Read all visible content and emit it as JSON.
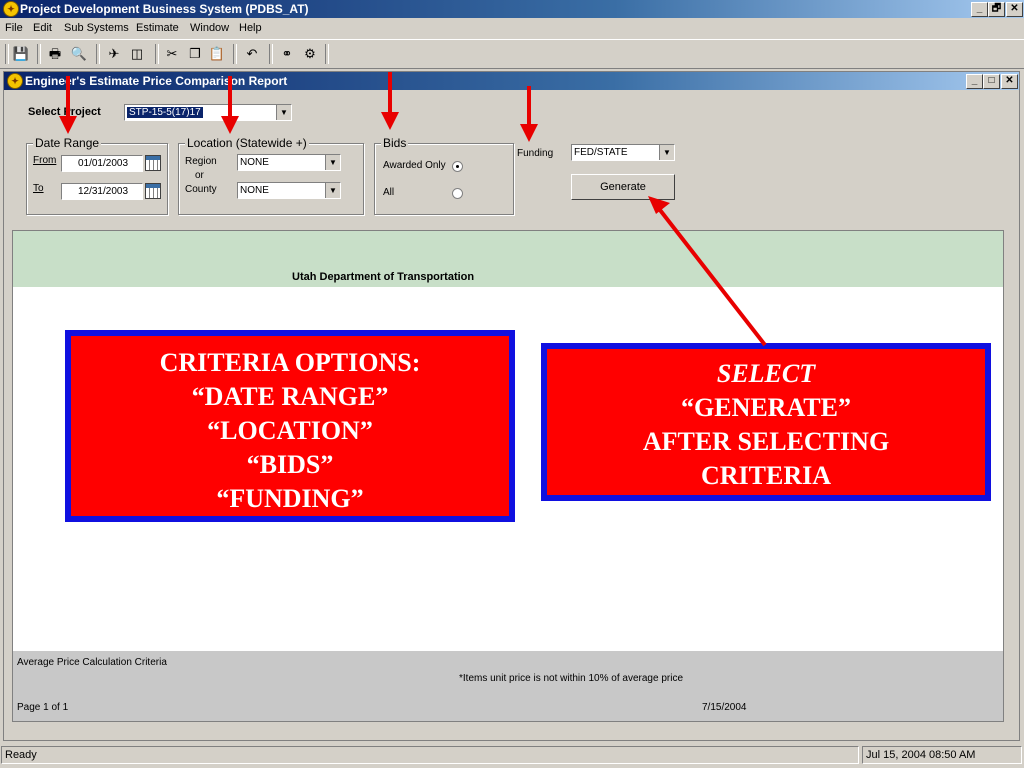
{
  "app": {
    "title": "Project Development Business System (PDBS_AT)",
    "window_buttons": [
      "_",
      "🗗",
      "✕"
    ]
  },
  "menu": [
    "File",
    "Edit",
    "Sub Systems",
    "Estimate",
    "Window",
    "Help"
  ],
  "toolbar": {
    "icons": [
      "save-icon",
      "print-icon",
      "print-preview-icon",
      "find-icon",
      "columns-icon",
      "cut-icon",
      "copy-icon",
      "paste-icon",
      "undo-icon",
      "binoculars-icon",
      "query-icon"
    ]
  },
  "child_window": {
    "title": "Engineer's Estimate Price Comparison Report",
    "window_buttons": [
      "_",
      "□",
      "✕"
    ]
  },
  "form": {
    "select_project_label": "Select Project",
    "project_value": "STP-15-5(17)17",
    "date_range": {
      "legend": "Date Range",
      "from_label": "From",
      "from_value": "01/01/2003",
      "to_label": "To",
      "to_value": "12/31/2003"
    },
    "location": {
      "legend": "Location (Statewide +)",
      "region_label": "Region",
      "or_label": "or",
      "county_label": "County",
      "region_value": "NONE",
      "county_value": "NONE"
    },
    "bids": {
      "legend": "Bids",
      "awarded_label": "Awarded Only",
      "all_label": "All",
      "selected": "Awarded Only"
    },
    "funding": {
      "label": "Funding",
      "value": "FED/STATE"
    },
    "generate_label": "Generate"
  },
  "report": {
    "org_title": "Utah Department of Transportation",
    "footer_criteria": "Average Price Calculation Criteria",
    "footer_note": "*Items unit price is not within 10% of average price",
    "page_label": "Page 1 of 1",
    "date": "7/15/2004"
  },
  "callouts": {
    "left": [
      "CRITERIA OPTIONS:",
      "“DATE RANGE”",
      "“LOCATION”",
      "“BIDS”",
      "“FUNDING”"
    ],
    "right_italic": "SELECT",
    "right": [
      "“GENERATE”",
      "AFTER SELECTING",
      "CRITERIA"
    ]
  },
  "annotation_color": "#e80000",
  "status": {
    "left": "Ready",
    "right": "Jul 15, 2004 08:50 AM"
  }
}
